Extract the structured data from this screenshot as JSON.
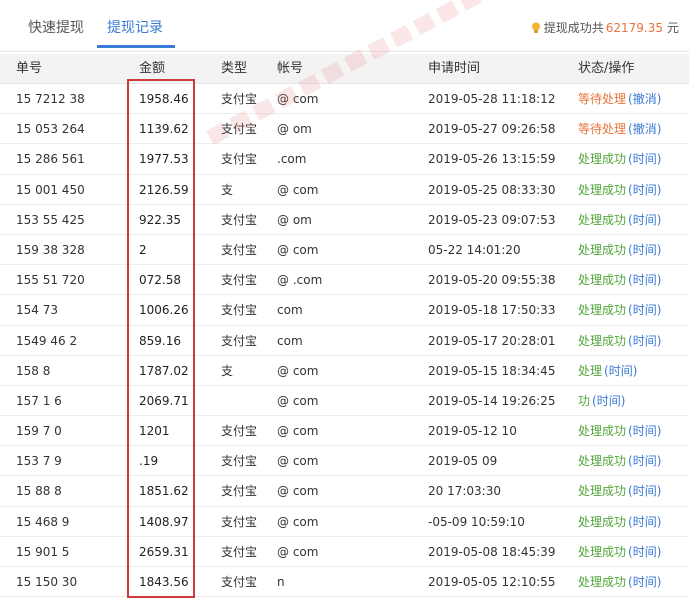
{
  "tabs": {
    "quick": "快速提现",
    "records": "提现记录"
  },
  "summary": {
    "label": "提现成功共",
    "amount": "62179.35",
    "unit": "元"
  },
  "table": {
    "headers": {
      "id": "单号",
      "amount": "金额",
      "type": "类型",
      "account": "帐号",
      "time": "申请时间",
      "status": "状态/操作"
    },
    "rows": [
      {
        "id": "15  7212  38",
        "amount": "1958.46",
        "type": "支付宝",
        "account": "@      com",
        "time": "2019-05-28 11:18:12",
        "status": "等待处理",
        "action": "(撤消)"
      },
      {
        "id": "15  053  264",
        "amount": "1139.62",
        "type": "支付宝",
        "account": "@      om",
        "time": "2019-05-27 09:26:58",
        "status": "等待处理",
        "action": "(撤消)"
      },
      {
        "id": "15  286  561",
        "amount": "1977.53",
        "type": "支付宝",
        "account": "     .com",
        "time": "2019-05-26 13:15:59",
        "status": "处理成功",
        "action": "(时间)"
      },
      {
        "id": "15  001  450",
        "amount": "2126.59",
        "type": "支",
        "account": "@     com",
        "time": "2019-05-25 08:33:30",
        "status": "处理成功",
        "action": "(时间)"
      },
      {
        "id": "153  55  425",
        "amount": "922.35",
        "type": "支付宝",
        "account": "@     om",
        "time": "2019-05-23 09:07:53",
        "status": "处理成功",
        "action": "(时间)"
      },
      {
        "id": "159  38  328",
        "amount": "2",
        "type": "支付宝",
        "account": "@     com",
        "time": "05-22 14:01:20",
        "status": "处理成功",
        "action": "(时间)"
      },
      {
        "id": "155  51  720",
        "amount": "072.58",
        "type": "支付宝",
        "account": "@     .com",
        "time": "2019-05-20 09:55:38",
        "status": "处理成功",
        "action": "(时间)"
      },
      {
        "id": "154  73",
        "amount": "1006.26",
        "type": "支付宝",
        "account": "     com",
        "time": "2019-05-18 17:50:33",
        "status": "处理成功",
        "action": "(时间)"
      },
      {
        "id": "1549  46  2",
        "amount": "859.16",
        "type": "支付宝",
        "account": "     com",
        "time": "2019-05-17 20:28:01",
        "status": "处理成功",
        "action": "(时间)"
      },
      {
        "id": "158  8",
        "amount": "1787.02",
        "type": "支",
        "account": "@     com",
        "time": "2019-05-15 18:34:45",
        "status": "处理",
        "action": "(时间)"
      },
      {
        "id": "157  1  6",
        "amount": "2069.71",
        "type": "",
        "account": "@     com",
        "time": "2019-05-14 19:26:25",
        "status": "功",
        "action": "(时间)"
      },
      {
        "id": "159  7  0",
        "amount": "1201",
        "type": "支付宝",
        "account": "@     com",
        "time": "2019-05-12 10",
        "status": "处理成功",
        "action": "(时间)"
      },
      {
        "id": "153  7  9",
        "amount": ".19",
        "type": "支付宝",
        "account": "@     com",
        "time": "2019-05  09",
        "status": "处理成功",
        "action": "(时间)"
      },
      {
        "id": "15  88  8",
        "amount": "1851.62",
        "type": "支付宝",
        "account": "@     com",
        "time": "20  17:03:30",
        "status": "处理成功",
        "action": "(时间)"
      },
      {
        "id": "15  468  9",
        "amount": "1408.97",
        "type": "支付宝",
        "account": "@     com",
        "time": "-05-09 10:59:10",
        "status": "处理成功",
        "action": "(时间)"
      },
      {
        "id": "15  901  5",
        "amount": "2659.31",
        "type": "支付宝",
        "account": "@     com",
        "time": "2019-05-08 18:45:39",
        "status": "处理成功",
        "action": "(时间)"
      },
      {
        "id": "15  150  30",
        "amount": "1843.56",
        "type": "支付宝",
        "account": "n",
        "time": "2019-05-05 12:10:55",
        "status": "处理成功",
        "action": "(时间)"
      }
    ]
  },
  "colors": {
    "accent": "#3a7bd5",
    "pending": "#e8743b",
    "success": "#52a63a",
    "highlight": "#d03a3a"
  },
  "icons": {
    "summary": "lightbulb-icon"
  }
}
